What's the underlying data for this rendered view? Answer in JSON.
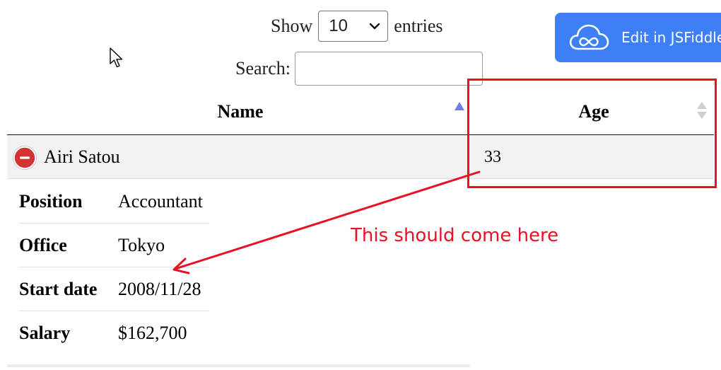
{
  "controls": {
    "show_label": "Show",
    "entries_value": "10",
    "entries_label": "entries",
    "search_label": "Search:",
    "search_value": ""
  },
  "jsfiddle": {
    "label": "Edit in JSFiddle",
    "icon": "cloud-infinity-icon",
    "color": "#3d7ff5"
  },
  "table": {
    "columns": [
      "Name",
      "Age"
    ],
    "sort": {
      "Name": "ascending",
      "Age": "none"
    },
    "rows": [
      {
        "name": "Airi Satou",
        "age": "33",
        "expanded": true
      }
    ],
    "details": [
      {
        "label": "Position",
        "value": "Accountant"
      },
      {
        "label": "Office",
        "value": "Tokyo"
      },
      {
        "label": "Start date",
        "value": "2008/11/28"
      },
      {
        "label": "Salary",
        "value": "$162,700"
      }
    ]
  },
  "annotation": {
    "text": "This should come here",
    "color": "#e81224"
  }
}
